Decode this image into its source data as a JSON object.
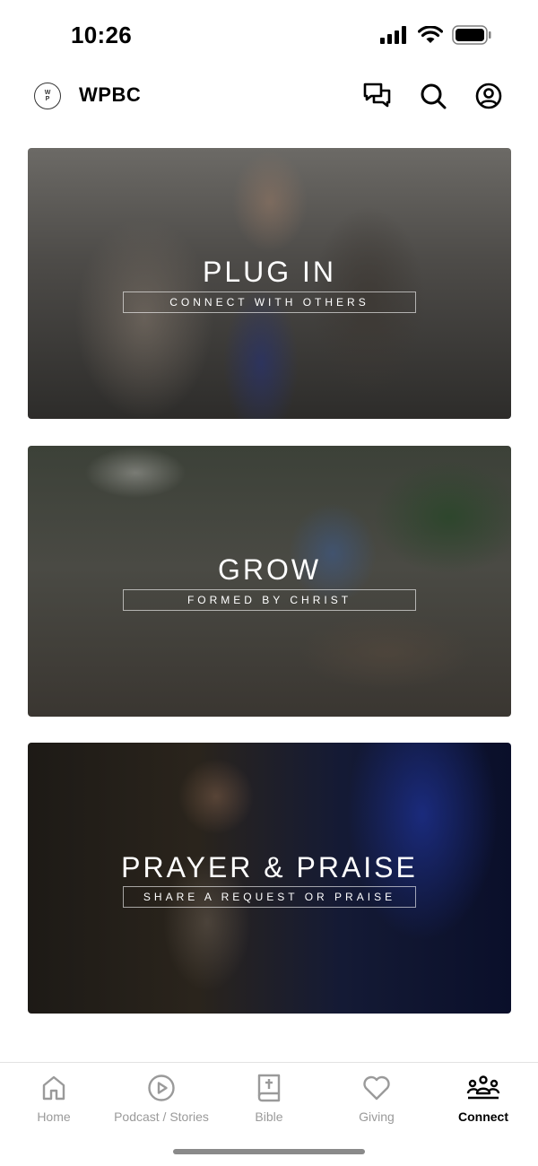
{
  "status_bar": {
    "time": "10:26"
  },
  "header": {
    "logo_top": "W",
    "logo_bottom": "P",
    "title": "WPBC"
  },
  "cards": [
    {
      "title": "PLUG IN",
      "subtitle": "CONNECT WITH OTHERS"
    },
    {
      "title": "GROW",
      "subtitle": "FORMED BY CHRIST"
    },
    {
      "title": "PRAYER & PRAISE",
      "subtitle": "SHARE A REQUEST OR PRAISE"
    }
  ],
  "tabs": [
    {
      "label": "Home",
      "icon": "home-icon",
      "active": false
    },
    {
      "label": "Podcast / Stories",
      "icon": "play-circle-icon",
      "active": false
    },
    {
      "label": "Bible",
      "icon": "bible-icon",
      "active": false
    },
    {
      "label": "Giving",
      "icon": "heart-icon",
      "active": false
    },
    {
      "label": "Connect",
      "icon": "group-icon",
      "active": true
    }
  ],
  "colors": {
    "active_tab": "#000000",
    "inactive_tab": "#9a9a9a",
    "background": "#ffffff"
  }
}
